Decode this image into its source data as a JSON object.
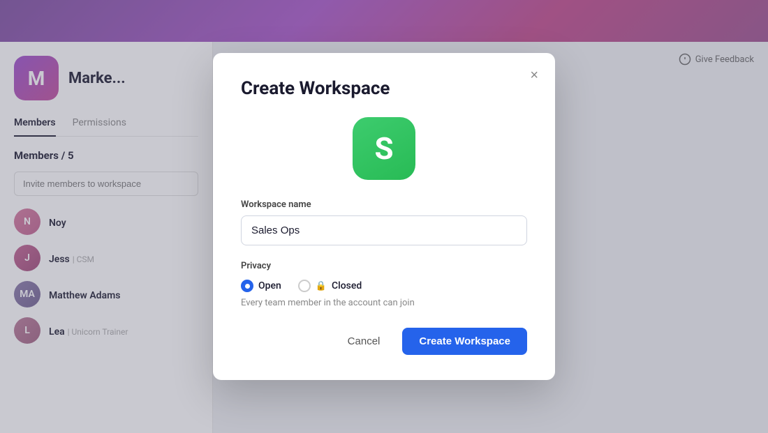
{
  "header": {
    "bg_gradient": "linear-gradient(135deg, #7c4d9f, #a855c8, #c0478a)"
  },
  "workspace": {
    "icon_letter": "M",
    "name": "Marke..."
  },
  "tabs": [
    {
      "label": "Members",
      "active": true
    },
    {
      "label": "Permissions",
      "active": false
    }
  ],
  "members_section": {
    "heading": "Members / 5",
    "invite_placeholder": "Invite members to workspace"
  },
  "members": [
    {
      "name": "Noy",
      "role": "",
      "initials": "N",
      "color": "#d4789e"
    },
    {
      "name": "Jess",
      "role": "CSM",
      "initials": "J",
      "color": "#c06090"
    },
    {
      "name": "Matthew Adams",
      "role": "",
      "initials": "MA",
      "color": "#8878a8"
    },
    {
      "name": "Lea",
      "role": "Unicorn Trainer",
      "initials": "L",
      "color": "#b87898"
    }
  ],
  "feedback": {
    "label": "Give Feedback"
  },
  "modal": {
    "title": "Create Workspace",
    "icon_letter": "S",
    "workspace_name_label": "Workspace name",
    "workspace_name_value": "Sales Ops",
    "workspace_name_placeholder": "Sales Ops",
    "privacy_label": "Privacy",
    "privacy_options": [
      {
        "id": "open",
        "label": "Open",
        "selected": true
      },
      {
        "id": "closed",
        "label": "Closed",
        "selected": false
      }
    ],
    "privacy_description": "Every team member in the account can join",
    "cancel_label": "Cancel",
    "create_label": "Create Workspace",
    "close_icon": "×"
  }
}
